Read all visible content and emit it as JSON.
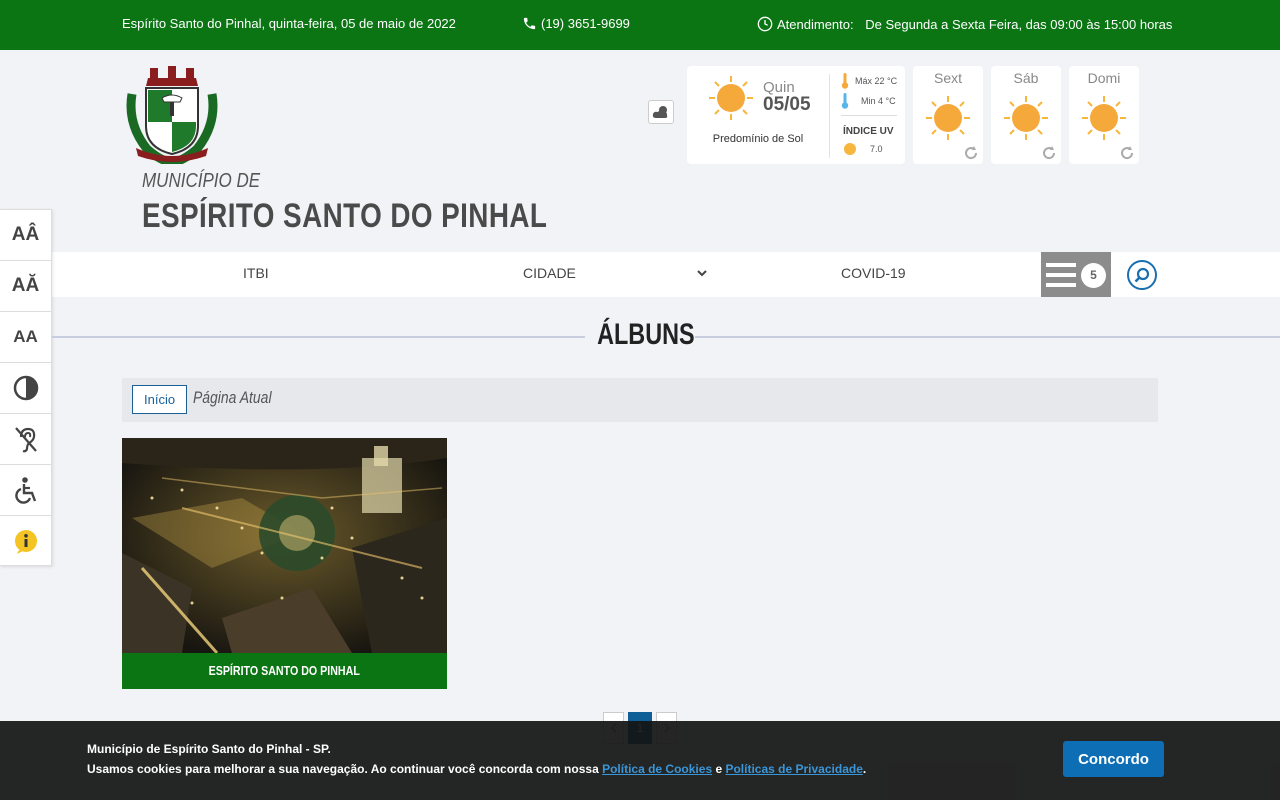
{
  "topbar": {
    "date": "Espírito Santo do Pinhal, quinta-feira, 05 de maio de 2022",
    "phone": "(19) 3651-9699",
    "hours_label": "Atendimento:",
    "hours_value": "De Segunda a Sexta Feira, das 09:00 às 15:00 horas"
  },
  "header": {
    "municipality_prefix": "MUNICÍPIO DE",
    "municipality_name": "ESPÍRITO SANTO DO PINHAL"
  },
  "weather": {
    "today": {
      "day": "Quin",
      "date": "05/05",
      "description": "Predomínio de Sol",
      "max": "Máx 22 °C",
      "min": "Min 4 °C",
      "uv_label": "ÍNDICE UV",
      "uv_value": "7.0"
    },
    "forecast": [
      {
        "day": "Sext"
      },
      {
        "day": "Sáb"
      },
      {
        "day": "Domi"
      }
    ]
  },
  "nav": {
    "items": [
      "ITBI",
      "CIDADE",
      "COVID-19"
    ],
    "menu_badge": "5"
  },
  "accessibility": {
    "increase_font": "AÂ",
    "default_font": "AĂ",
    "decrease_font": "AA"
  },
  "page": {
    "title": "ÁLBUNS",
    "breadcrumb_home": "Início",
    "breadcrumb_current": "Página Atual"
  },
  "albums": [
    {
      "title": "ESPÍRITO SANTO DO PINHAL"
    }
  ],
  "pagination": {
    "current": "1"
  },
  "cookie": {
    "line1": "Município de Espírito Santo do Pinhal - SP.",
    "line2_pre": "Usamos cookies para melhorar a sua navegação. Ao continuar você concorda com nossa ",
    "cookies_link": "Política de Cookies",
    "and": " e ",
    "privacy_link": "Políticas de Privacidade",
    "line2_post": ".",
    "agree_button": "Concordo"
  },
  "colors": {
    "brand_green": "#0b7514",
    "link_blue": "#0d6eb5",
    "menu_gray": "#8c8c8c"
  }
}
